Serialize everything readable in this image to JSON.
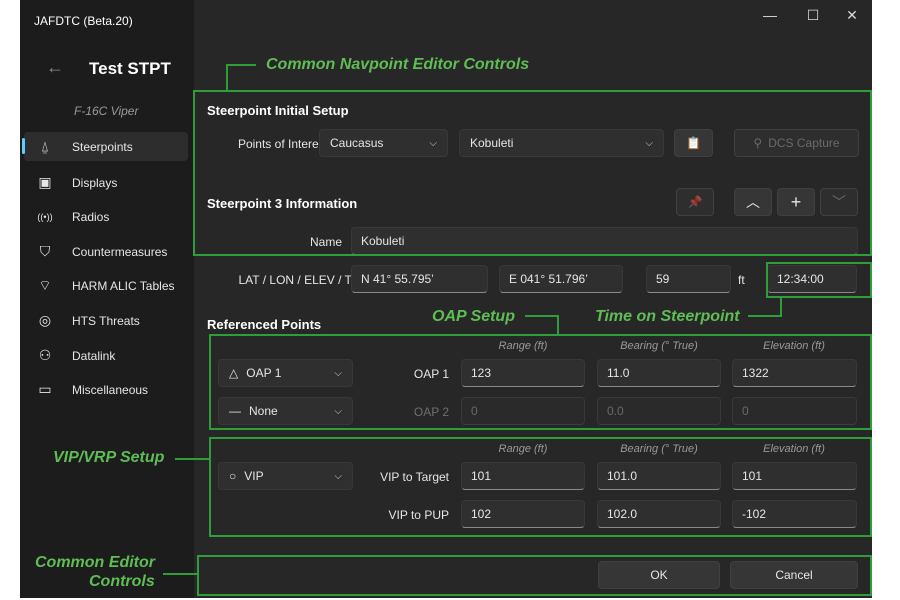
{
  "window": {
    "title": "JAFDTC (Beta.20)",
    "minimize_glyph": "—",
    "maximize_glyph": "☐",
    "close_glyph": "✕"
  },
  "sidebar": {
    "config_name": "Test STPT",
    "back_glyph": "←",
    "airframe": "F-16C Viper",
    "items": [
      {
        "label": "Steerpoints",
        "icon": "steerpoint-icon",
        "glyph": "⍙"
      },
      {
        "label": "Displays",
        "icon": "chip-icon",
        "glyph": "▣"
      },
      {
        "label": "Radios",
        "icon": "radio-icon",
        "glyph": "((•))"
      },
      {
        "label": "Countermeasures",
        "icon": "shield-icon",
        "glyph": "⛉"
      },
      {
        "label": "HARM ALIC Tables",
        "icon": "wifi-icon",
        "glyph": "⌔"
      },
      {
        "label": "HTS Threats",
        "icon": "target-icon",
        "glyph": "◎"
      },
      {
        "label": "Datalink",
        "icon": "people-icon",
        "glyph": "⚇"
      },
      {
        "label": "Miscellaneous",
        "icon": "folder-icon",
        "glyph": "▭"
      }
    ]
  },
  "initial_setup": {
    "header": "Steerpoint Initial Setup",
    "poi_label": "Points of Interest",
    "theater": "Caucasus",
    "poi": "Kobuleti",
    "paste_glyph": "📋",
    "dcs_capture": "DCS Capture",
    "dcs_glyph": "⚲"
  },
  "info": {
    "header": "Steerpoint 3 Information",
    "name_label": "Name",
    "name_value": "Kobuleti",
    "pos_label": "LAT / LON / ELEV / TOS",
    "lat": "N 41° 55.795’",
    "lon": "E 041° 51.796’",
    "elev": "59",
    "elev_unit": "ft",
    "tos": "12:34:00",
    "pin_glyph": "📌",
    "up_glyph": "︿",
    "add_glyph": "+",
    "down_glyph": "﹀"
  },
  "referenced": {
    "header": "Referenced Points",
    "col_range": "Range (ft)",
    "col_bearing": "Bearing (° True)",
    "col_elev": "Elevation (ft)",
    "oap_rows": [
      {
        "type": "OAP 1",
        "type_glyph": "△",
        "label": "OAP 1",
        "range": "123",
        "bearing": "11.0",
        "elev": "1322"
      },
      {
        "type": "None",
        "type_glyph": "—",
        "label": "OAP 2",
        "range": "0",
        "bearing": "0.0",
        "elev": "0"
      }
    ],
    "vip_type": "VIP",
    "vip_glyph": "○",
    "vip_rows": [
      {
        "label": "VIP to Target",
        "range": "101",
        "bearing": "101.0",
        "elev": "101"
      },
      {
        "label": "VIP to PUP",
        "range": "102",
        "bearing": "102.0",
        "elev": "-102"
      }
    ]
  },
  "footer": {
    "ok": "OK",
    "cancel": "Cancel"
  },
  "annotations": {
    "navpoint": "Common Navpoint Editor Controls",
    "oap": "OAP Setup",
    "tos": "Time on Steerpoint",
    "vip": "VIP/VRP Setup",
    "editor_line1": "Common Editor",
    "editor_line2": "Controls"
  },
  "colors": {
    "accent": "#60cdff",
    "annotation": "#2f9e3a",
    "annotation_text": "#5fbd55"
  }
}
